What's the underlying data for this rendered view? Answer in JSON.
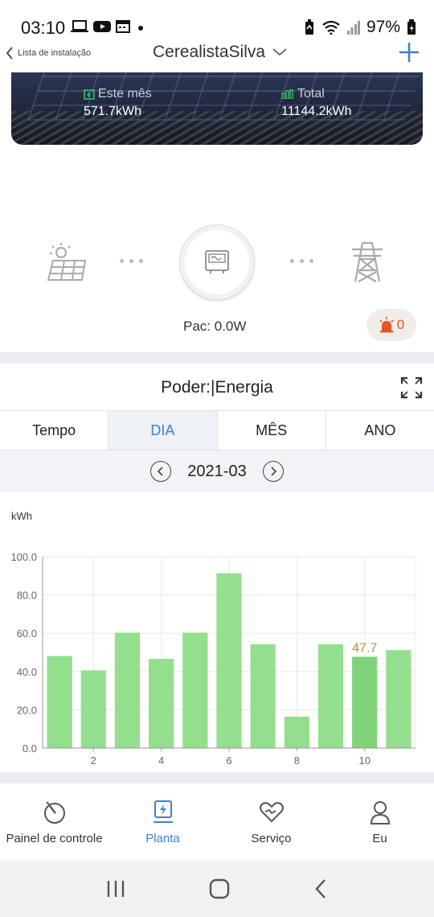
{
  "status_bar": {
    "time": "03:10",
    "battery": "97%"
  },
  "header": {
    "back_label": "Lista de instalação",
    "plant_name": "CerealistaSilva"
  },
  "banner": {
    "month_label": "Este mês",
    "month_value": "571.7kWh",
    "total_label": "Total",
    "total_value": "11144.2kWh"
  },
  "flow": {
    "pac_text": "Pac: 0.0W",
    "alarm_count": "0"
  },
  "chart_section": {
    "title": "Poder:|Energia",
    "tabs": [
      {
        "label": "Tempo",
        "active": false
      },
      {
        "label": "DIA",
        "active": true
      },
      {
        "label": "MÊS",
        "active": false
      },
      {
        "label": "ANO",
        "active": false
      }
    ],
    "date": "2021-03"
  },
  "chart_data": {
    "type": "bar",
    "ylabel": "kWh",
    "ylim": [
      0,
      100
    ],
    "yticks": [
      "0.0",
      "20.0",
      "40.0",
      "60.0",
      "80.0",
      "100.0"
    ],
    "x": [
      1,
      2,
      3,
      4,
      5,
      6,
      7,
      8,
      9,
      10,
      11
    ],
    "xtick_labels": [
      "",
      "2",
      "",
      "4",
      "",
      "6",
      "",
      "8",
      "",
      "10",
      ""
    ],
    "values": [
      48.1,
      40.6,
      60.3,
      46.6,
      60.3,
      91.3,
      54.2,
      16.4,
      54.2,
      47.7,
      51.2
    ],
    "highlight_index": 9,
    "highlight_label": "47.7",
    "bar_color": "#93df8d",
    "highlight_color": "#80d17a",
    "label_color": "#b8932f",
    "grid": true
  },
  "bottom_nav": [
    {
      "label": "Painel de controle",
      "icon": "dashboard-icon",
      "active": false
    },
    {
      "label": "Planta",
      "icon": "plant-icon",
      "active": true
    },
    {
      "label": "Serviço",
      "icon": "service-icon",
      "active": false
    },
    {
      "label": "Eu",
      "icon": "user-icon",
      "active": false
    }
  ],
  "colors": {
    "accent": "#3f7fd0",
    "alarm": "#e2572a"
  }
}
